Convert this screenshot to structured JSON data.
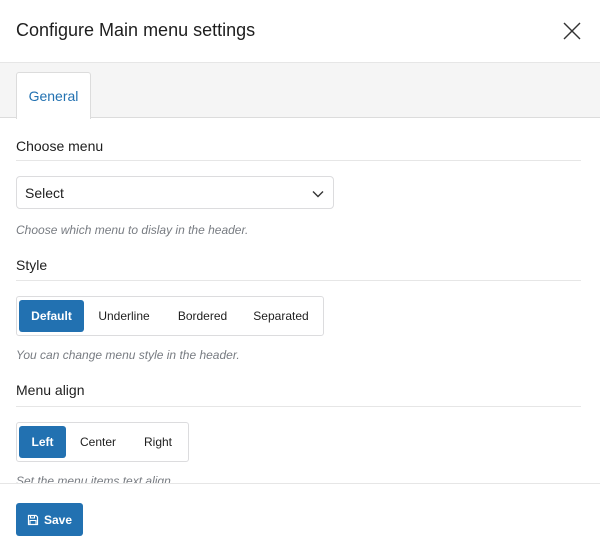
{
  "dialog": {
    "title": "Configure Main menu settings"
  },
  "tabs": [
    {
      "label": "General",
      "active": true
    }
  ],
  "sections": {
    "choose_menu": {
      "title": "Choose menu",
      "select_value": "Select",
      "help": "Choose which menu to dislay in the header."
    },
    "style": {
      "title": "Style",
      "options": [
        "Default",
        "Underline",
        "Bordered",
        "Separated"
      ],
      "selected": "Default",
      "help": "You can change menu style in the header."
    },
    "menu_align": {
      "title": "Menu align",
      "options": [
        "Left",
        "Center",
        "Right"
      ],
      "selected": "Left",
      "help": "Set the menu items text align."
    }
  },
  "footer": {
    "save_label": "Save"
  },
  "icons": {
    "close": "close-icon",
    "chevron": "chevron-down-icon",
    "save": "save-icon"
  },
  "colors": {
    "accent": "#2271b1",
    "text": "#1e1e1e",
    "muted": "#787c82",
    "border": "#dcdcde"
  }
}
